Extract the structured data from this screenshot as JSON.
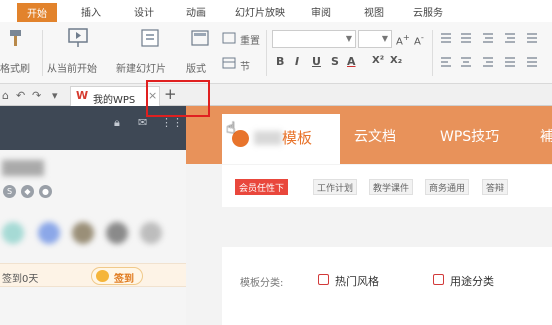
{
  "ribbon": {
    "tabs": [
      "开始",
      "插入",
      "设计",
      "动画",
      "幻灯片放映",
      "审阅",
      "视图",
      "云服务"
    ],
    "active_tab": "开始",
    "buttons": {
      "format_painter": "格式刷",
      "from_current": "从当前开始",
      "new_slide": "新建幻灯片",
      "layout": "版式",
      "reset": "重置",
      "section": "节"
    },
    "format_buttons": [
      "B",
      "I",
      "U",
      "S",
      "A",
      "X²",
      "X₂"
    ]
  },
  "quick_bar": {
    "doc_tab_label": "我的WPS",
    "new_tab_symbol": "+"
  },
  "left_panel": {
    "checkin_days": "签到0天",
    "checkin_button": "签到"
  },
  "main": {
    "header_tabs": {
      "templates": "模板",
      "cloud_docs": "云文档",
      "wps_tips": "WPS技巧",
      "more_cut": "補"
    },
    "filter_chips": [
      "会员任性下",
      "工作计划",
      "教学课件",
      "商务通用",
      "答辩"
    ],
    "category_label": "模板分类:",
    "categories": [
      "热门风格",
      "用途分类"
    ]
  },
  "colors": {
    "accent_orange": "#e2832c",
    "header_orange": "#e8925a",
    "chip_red": "#e9473c",
    "dark_panel": "#3e4855",
    "highlight_red": "#e02020"
  }
}
